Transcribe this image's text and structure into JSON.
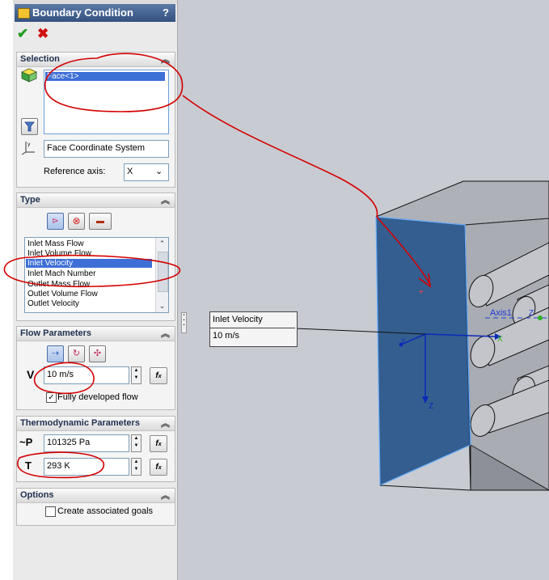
{
  "panel": {
    "title": "Boundary Condition",
    "help": "?"
  },
  "selection": {
    "header": "Selection",
    "face_item": "Face<1>",
    "coord_system": "Face Coordinate System",
    "reference_axis_label": "Reference axis:",
    "reference_axis_value": "X"
  },
  "type": {
    "header": "Type",
    "items": [
      "Inlet Mass Flow",
      "Inlet Volume Flow",
      "Inlet Velocity",
      "Inlet Mach Number",
      "Outlet Mass Flow",
      "Outlet Volume Flow",
      "Outlet Velocity"
    ],
    "selected": "Inlet Velocity"
  },
  "flow": {
    "header": "Flow Parameters",
    "velocity_symbol": "V",
    "velocity_value": "10 m/s",
    "fully_developed_label": "Fully developed flow",
    "fully_developed_checked": true
  },
  "thermo": {
    "header": "Thermodynamic Parameters",
    "pressure_symbol": "~P",
    "pressure_value": "101325 Pa",
    "temperature_symbol": "T",
    "temperature_value": "293 K"
  },
  "options": {
    "header": "Options",
    "goals_label": "Create associated goals",
    "goals_checked": false
  },
  "callout": {
    "name": "Inlet Velocity",
    "value": "10 m/s"
  },
  "viewport": {
    "axis_label": "Axis1",
    "x_label": "X",
    "y_label": "Y",
    "z_label": "Z",
    "z2_label": "Z"
  },
  "colors": {
    "header_blue": "#33507f",
    "selection_blue": "#3d6fd6",
    "highlight_face": "#1f4f85",
    "annotation_red": "#d40000",
    "ok_green": "#22a022",
    "cancel_red": "#d11010"
  }
}
